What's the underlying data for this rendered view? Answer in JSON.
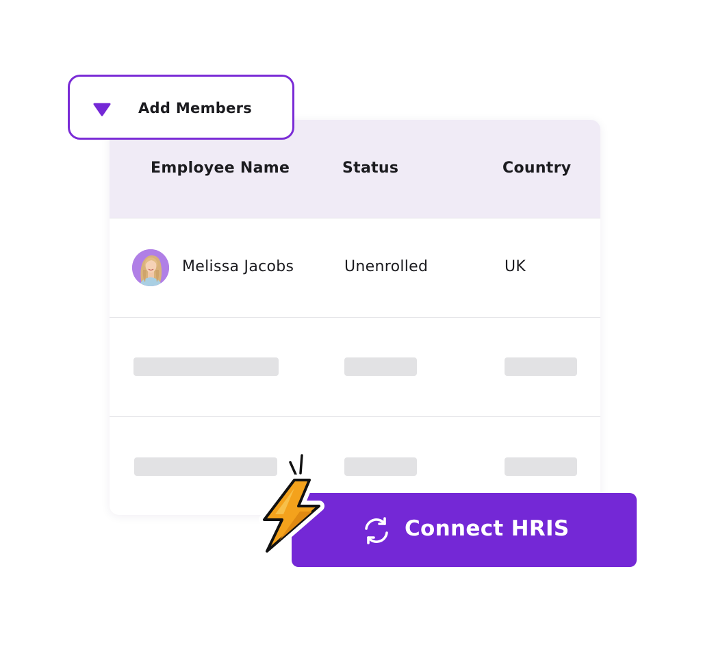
{
  "add_members": {
    "label": "Add Members",
    "icon": "triangle-down-icon"
  },
  "table": {
    "columns": [
      "Employee Name",
      "Status",
      "Country"
    ],
    "rows": [
      {
        "name": "Melissa Jacobs",
        "status": "Unenrolled",
        "country": "UK",
        "avatar": "user-avatar"
      }
    ],
    "placeholder_rows": 2
  },
  "connect_button": {
    "label": "Connect HRIS",
    "icon": "sync-icon"
  },
  "decoration": {
    "icon": "lightning-bolt-icon"
  },
  "colors": {
    "accent": "#7428d6",
    "header_bg": "#f0ebf6",
    "skeleton": "#e2e2e4",
    "bolt": "#f4a21c"
  }
}
